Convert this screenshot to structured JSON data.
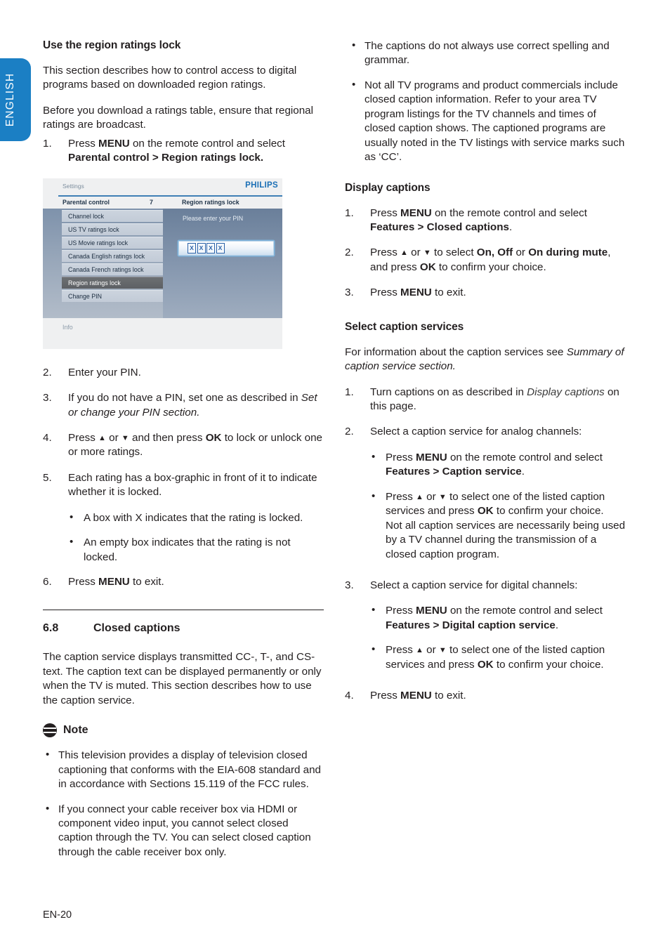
{
  "language_tab": {
    "label": "ENGLISH"
  },
  "footer": {
    "folio": "EN-20"
  },
  "left_column": {
    "heading": "Use the region ratings lock",
    "para1": "This section describes how to control access to digital programs based on downloaded region ratings.",
    "para2": "Before you download a ratings table, ensure that regional ratings are broadcast.",
    "step1": {
      "number": "1.",
      "text_a": "Press ",
      "menu": "MENU",
      "text_b": " on the remote control and select ",
      "path1": "Parental control",
      "gt": " > ",
      "path2": "Region ratings lock."
    },
    "steps": [
      {
        "number": "2.",
        "text": "Enter your PIN."
      },
      {
        "number": "3.",
        "text_a": "If you do not have a PIN, set one as described in ",
        "italic": "Set or change your PIN section."
      },
      {
        "number": "4.",
        "text_a": "Press ",
        "up": "▲",
        "or": " or ",
        "down": "▼",
        "text_b": " and then press ",
        "ok": "OK",
        "text_c": " to lock or unlock one or more ratings."
      },
      {
        "number": "5.",
        "text": "Each rating has a box-graphic in front of it to indicate whether it is locked."
      },
      {
        "number": "6.",
        "text_a": "Press ",
        "menu": "MENU",
        "text_b": " to exit."
      }
    ],
    "step5_bullets": [
      {
        "bullet": "•",
        "text": "A box with X indicates that the rating is locked."
      },
      {
        "bullet": "•",
        "text": "An empty box indicates that the rating is not locked."
      }
    ],
    "section": {
      "number": "6.8",
      "title": "Closed captions",
      "para": "The caption service displays transmitted CC-, T-, and CS- text.  The caption text can be displayed permanently or only when the TV is muted.  This section describes how to use the caption service."
    },
    "note": {
      "icon": "note-icon",
      "title": "Note",
      "bullets": [
        {
          "bullet": "•",
          "text": "This television provides a display of television closed captioning that conforms with the EIA-608 standard and in accordance with Sections 15.119 of the FCC rules."
        },
        {
          "bullet": "•",
          "text": "If you connect your cable receiver box via HDMI or component video input, you cannot select closed caption through the TV.  You can select closed caption through the cable receiver box only."
        }
      ]
    }
  },
  "tv_screenshot": {
    "settings_label": "Settings",
    "brand": "PHILIPS",
    "crumb_left": "Parental control",
    "crumb_count": "7",
    "crumb_right": "Region ratings lock",
    "menu_items": [
      {
        "label": "Channel lock",
        "selected": false
      },
      {
        "label": "US TV ratings lock",
        "selected": false
      },
      {
        "label": "US Movie ratings lock",
        "selected": false
      },
      {
        "label": "Canada English ratings lock",
        "selected": false
      },
      {
        "label": "Canada French ratings lock",
        "selected": false
      },
      {
        "label": "Region ratings lock",
        "selected": true
      },
      {
        "label": "Change PIN",
        "selected": false
      }
    ],
    "pin_prompt": "Please enter your PIN",
    "pin_digits": [
      "X",
      "X",
      "X",
      "X"
    ],
    "info_label": "Info",
    "colors": {
      "brand_blue": "#1b6fb5",
      "rule_blue": "#3f7fb5",
      "selection_gray": "#6d6f72",
      "pin_border_blue": "#2b62a8"
    }
  },
  "right_column": {
    "top_bullets": [
      {
        "bullet": "•",
        "text": "The captions do not always use correct spelling and grammar."
      },
      {
        "bullet": "•",
        "text": "Not all TV programs and product commercials include closed caption information.  Refer to your area TV program listings for the TV channels and times of closed caption shows.  The captioned programs are usually noted in the TV listings with service marks such as ‘CC’."
      }
    ],
    "display_captions": {
      "heading": "Display captions",
      "step1": {
        "number": "1.",
        "a": "Press ",
        "menu": "MENU",
        "b": " on the remote control and select ",
        "p1": "Features",
        "gt": " > ",
        "p2": "Closed captions",
        "period": "."
      },
      "step2": {
        "number": "2.",
        "a": "Press ",
        "up": "▲",
        "or": " or ",
        "down": "▼",
        "b": " to select ",
        "o1": "On, Off",
        "or2": " or ",
        "o2": "On during mute",
        "c": ", and press ",
        "ok": "OK",
        "d": " to confirm your choice."
      },
      "step3": {
        "number": "3.",
        "a": "Press ",
        "menu": "MENU",
        "b": " to exit."
      }
    },
    "select_caption_services": {
      "heading": "Select caption services",
      "intro_a": "For information about the caption services see ",
      "intro_i": "Summary of caption service section.",
      "step1": {
        "number": "1.",
        "a": "Turn captions on as described in ",
        "i": "Display captions",
        "b": " on this page."
      },
      "step2": {
        "number": "2.",
        "text": "Select a caption service for analog channels:"
      },
      "step2_bullets": [
        {
          "bullet": "•",
          "a": "Press ",
          "menu": "MENU",
          "b": " on the remote control and select ",
          "p1": "Features",
          "gt": " > ",
          "p2": "Caption service",
          "period": "."
        },
        {
          "bullet": "•",
          "a": "Press ",
          "up": "▲",
          "or": " or ",
          "down": "▼",
          "b": " to select one of the listed caption services and press ",
          "ok": "OK",
          "c": " to confirm your choice.",
          "extra": "Not all caption services are necessarily being used by a TV channel during the transmission of a closed caption program."
        }
      ],
      "step3": {
        "number": "3.",
        "text": "Select a caption service for digital channels:"
      },
      "step3_bullets": [
        {
          "bullet": "•",
          "a": "Press ",
          "menu": "MENU",
          "b": " on the remote control and select ",
          "p1": "Features",
          "gt": " > ",
          "p2": "Digital caption service",
          "period": "."
        },
        {
          "bullet": "•",
          "a": "Press ",
          "up": "▲",
          "or": " or ",
          "down": "▼",
          "b": " to select one of the listed caption services and press ",
          "ok": "OK",
          "c": " to confirm your choice."
        }
      ],
      "step4": {
        "number": "4.",
        "a": "Press ",
        "menu": "MENU",
        "b": " to exit."
      }
    }
  }
}
